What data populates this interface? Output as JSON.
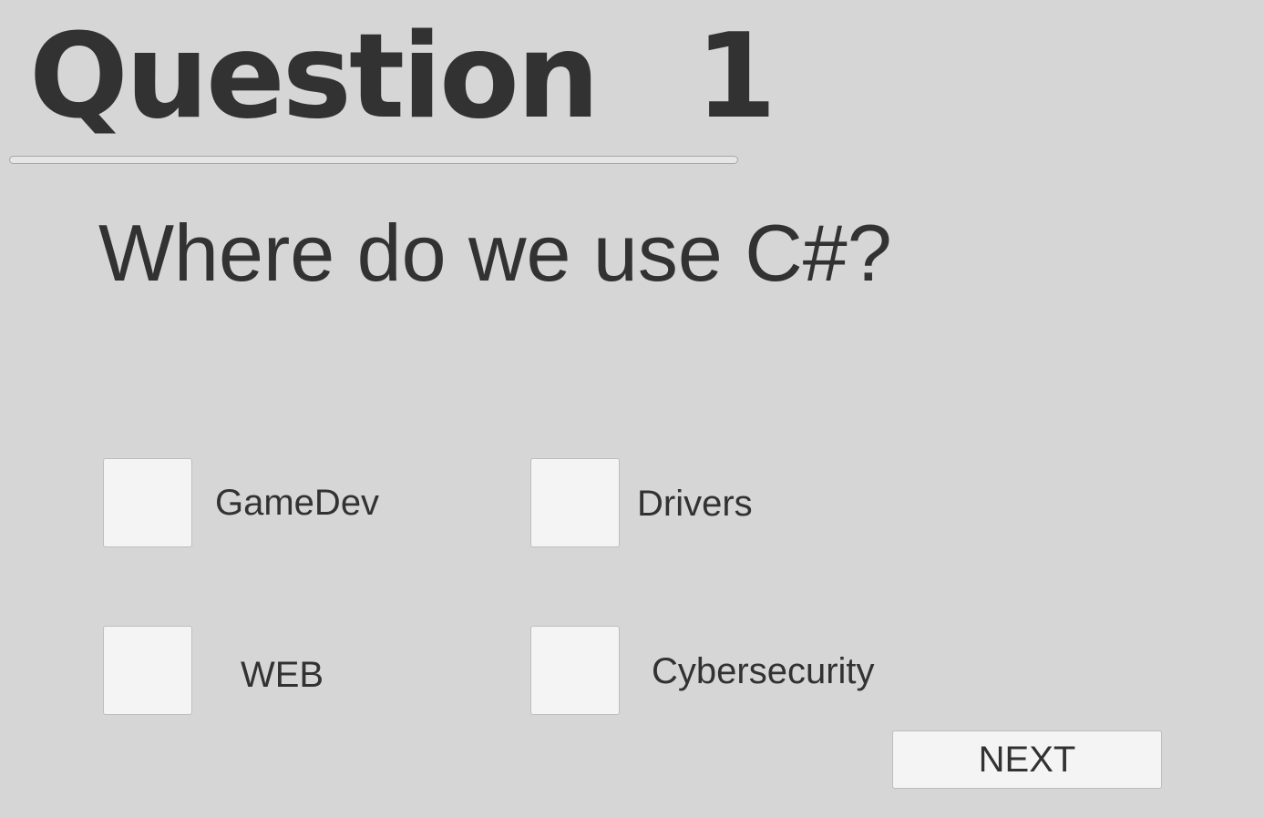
{
  "header": {
    "title_word": "Question",
    "question_number": "1"
  },
  "progress": {
    "value": 0
  },
  "question": {
    "text": "Where do we use C#?"
  },
  "options": [
    {
      "label": "GameDev",
      "checked": false
    },
    {
      "label": "Drivers",
      "checked": false
    },
    {
      "label": "WEB",
      "checked": false
    },
    {
      "label": "Cybersecurity",
      "checked": false
    }
  ],
  "buttons": {
    "next_label": "NEXT"
  },
  "colors": {
    "background": "#d6d6d6",
    "text": "#323232",
    "control_fill": "#f4f4f4"
  }
}
